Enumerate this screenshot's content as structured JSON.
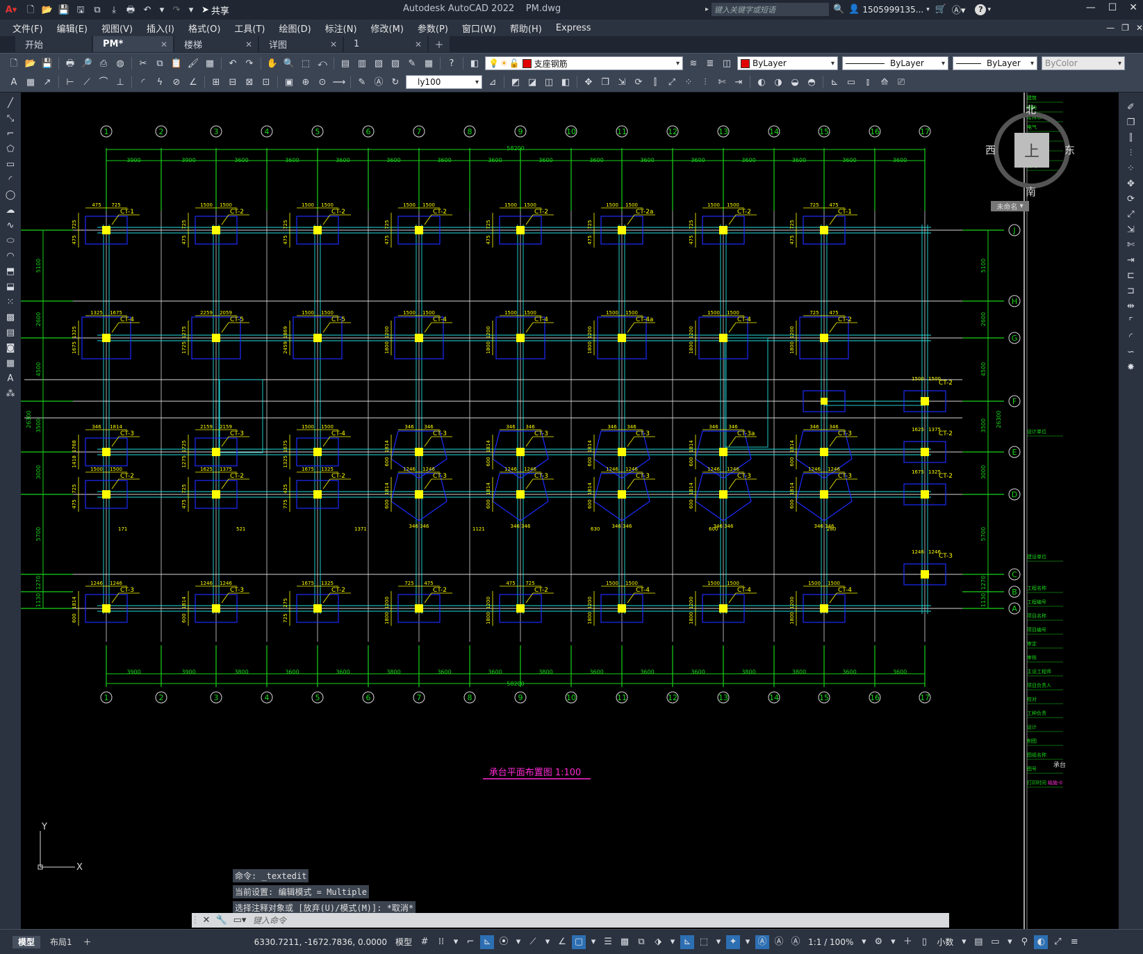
{
  "app": {
    "title": "Autodesk AutoCAD 2022",
    "file": "PM.dwg",
    "share_label": "共享",
    "search_placeholder": "键入关键字或短语",
    "user": "1505999135...",
    "window_controls": [
      "minimize-icon",
      "maximize-icon",
      "close-icon"
    ]
  },
  "menu": [
    "文件(F)",
    "编辑(E)",
    "视图(V)",
    "插入(I)",
    "格式(O)",
    "工具(T)",
    "绘图(D)",
    "标注(N)",
    "修改(M)",
    "参数(P)",
    "窗口(W)",
    "帮助(H)",
    "Express"
  ],
  "tabs": [
    {
      "label": "开始",
      "closable": false
    },
    {
      "label": "PM*",
      "closable": true,
      "active": true
    },
    {
      "label": "楼梯",
      "closable": true
    },
    {
      "label": "详图",
      "closable": true
    },
    {
      "label": "1",
      "closable": true
    }
  ],
  "properties": {
    "layer": "支座钢筋",
    "layer_color": "#e00000",
    "color": "ByLayer",
    "linetype": "ByLayer",
    "lineweight": "ByLayer",
    "plotstyle": "ByColor",
    "dimstyle": "ly100"
  },
  "viewcube": {
    "north": "北",
    "south": "南",
    "west": "西",
    "east": "东",
    "top": "上",
    "ucs": "未命名"
  },
  "drawing": {
    "top_axis_labels": [
      "1",
      "2",
      "3",
      "4",
      "5",
      "6",
      "7",
      "8",
      "9",
      "10",
      "11",
      "12",
      "13",
      "14",
      "15",
      "16",
      "17"
    ],
    "row_axis_labels": [
      "J",
      "H",
      "G",
      "F",
      "E",
      "D",
      "C",
      "B",
      "A"
    ],
    "bay_dims": [
      "3900",
      "3900",
      "3600",
      "3600",
      "3600",
      "3600",
      "3600",
      "3600",
      "3600",
      "3600",
      "3600",
      "3600",
      "3600",
      "3600",
      "3600",
      "3600"
    ],
    "bay_dims_bottom": [
      "3900",
      "3900",
      "3800",
      "3600",
      "3600",
      "3800",
      "3600",
      "3600",
      "3800",
      "3600",
      "3600",
      "3600",
      "3800",
      "3800",
      "3600",
      "3600"
    ],
    "overall_dim": "58200",
    "side_dims": [
      "5100",
      "2600",
      "4500",
      "3500",
      "3000",
      "5700",
      "1270",
      "1130"
    ],
    "side_total": "26300",
    "title": "承台平面布置图 1:100",
    "title_color": "#ff2bd6",
    "pile_caps": [
      {
        "label": "CT-1",
        "d1": "475",
        "d2": "725",
        "v1": "725",
        "v2": "475"
      },
      {
        "label": "CT-2",
        "d1": "1500",
        "d2": "1500",
        "v1": "725",
        "v2": "475"
      },
      {
        "label": "CT-2",
        "d1": "1500",
        "d2": "1500",
        "v1": "725",
        "v2": "475"
      },
      {
        "label": "CT-2",
        "d1": "1500",
        "d2": "1500",
        "v1": "725",
        "v2": "475"
      },
      {
        "label": "CT-2",
        "d1": "1500",
        "d2": "1500",
        "v1": "725",
        "v2": "475"
      },
      {
        "label": "CT-2a",
        "d1": "1500",
        "d2": "1500",
        "v1": "725",
        "v2": "475"
      },
      {
        "label": "CT-2",
        "d1": "1500",
        "d2": "1500",
        "v1": "725",
        "v2": "475"
      },
      {
        "label": "CT-1",
        "d1": "725",
        "d2": "475",
        "v1": "725",
        "v2": "475"
      },
      {
        "label": "CT-4",
        "d1": "1325",
        "d2": "1675",
        "v1": "1325",
        "v2": "1675"
      },
      {
        "label": "CT-5",
        "d1": "2259",
        "d2": "2059",
        "v1": "1275",
        "v2": "1725"
      },
      {
        "label": "CT-5",
        "d1": "1500",
        "d2": "1500",
        "v1": "1869",
        "v2": "2459"
      },
      {
        "label": "CT-4",
        "d1": "1500",
        "d2": "1500",
        "v1": "1200",
        "v2": "1800"
      },
      {
        "label": "CT-4",
        "d1": "1500",
        "d2": "1500",
        "v1": "1200",
        "v2": "1800"
      },
      {
        "label": "CT-4a",
        "d1": "1500",
        "d2": "1500",
        "v1": "1200",
        "v2": "1800"
      },
      {
        "label": "CT-4",
        "d1": "1500",
        "d2": "1500",
        "v1": "1200",
        "v2": "1800"
      },
      {
        "label": "CT-2",
        "d1": "725",
        "d2": "475",
        "v1": "1200",
        "v2": "1800"
      },
      {
        "label": "CT-3",
        "d1": "346",
        "d2": "1814",
        "v1": "1768",
        "v2": "1418"
      },
      {
        "label": "CT-3",
        "d1": "2159",
        "d2": "2159",
        "v1": "1725",
        "v2": "1275"
      },
      {
        "label": "CT-4",
        "d1": "1500",
        "d2": "1500",
        "v1": "1675",
        "v2": "1325"
      },
      {
        "label": "CT-3",
        "d1": "346",
        "d2": "346",
        "v1": "1814",
        "v2": "600"
      },
      {
        "label": "CT-3",
        "d1": "346",
        "d2": "346",
        "v1": "1814",
        "v2": "600"
      },
      {
        "label": "CT-3",
        "d1": "346",
        "d2": "346",
        "v1": "1814",
        "v2": "600"
      },
      {
        "label": "CT-3a",
        "d1": "346",
        "d2": "346",
        "v1": "1814",
        "v2": "600"
      },
      {
        "label": "CT-3",
        "d1": "346",
        "d2": "346",
        "v1": "1814",
        "v2": "600"
      },
      {
        "label": "CT-2",
        "d1": "1500",
        "d2": "1500",
        "v1": "725",
        "v2": "475"
      },
      {
        "label": "CT-2",
        "d1": "1625",
        "d2": "1375",
        "v1": "725",
        "v2": "475"
      },
      {
        "label": "CT-2",
        "d1": "1675",
        "d2": "1325",
        "v1": "425",
        "v2": "775"
      },
      {
        "label": "CT-3",
        "d1": "1246",
        "d2": "1246",
        "v1": "1814",
        "v2": "600"
      },
      {
        "label": "CT-3",
        "d1": "1246",
        "d2": "1246",
        "v1": "1814",
        "v2": "600"
      },
      {
        "label": "CT-3",
        "d1": "1246",
        "d2": "1246",
        "v1": "1814",
        "v2": "600"
      },
      {
        "label": "CT-3",
        "d1": "1246",
        "d2": "1246",
        "v1": "1814",
        "v2": "600"
      },
      {
        "label": "CT-3",
        "d1": "1246",
        "d2": "1246",
        "v1": "1814",
        "v2": "600"
      },
      {
        "label": "CT-3",
        "d1": "1246",
        "d2": "1246",
        "v1": "1814",
        "v2": "600"
      },
      {
        "label": "CT-3",
        "d1": "1246",
        "d2": "1246",
        "v1": "1814",
        "v2": "600"
      },
      {
        "label": "CT-2",
        "d1": "1675",
        "d2": "1325",
        "v1": "275",
        "v2": "725"
      },
      {
        "label": "CT-2",
        "d1": "725",
        "d2": "475",
        "v1": "1200",
        "v2": "1800"
      },
      {
        "label": "CT-2",
        "d1": "475",
        "d2": "725",
        "v1": "1200",
        "v2": "1800"
      },
      {
        "label": "CT-4",
        "d1": "1500",
        "d2": "1500",
        "v1": "1200",
        "v2": "1800"
      },
      {
        "label": "CT-4",
        "d1": "1500",
        "d2": "1500",
        "v1": "1200",
        "v2": "1800"
      },
      {
        "label": "CT-4",
        "d1": "1500",
        "d2": "1500",
        "v1": "1200",
        "v2": "1800"
      },
      {
        "label": "CT-4",
        "d1": "1500",
        "d2": "1500",
        "v1": "1200",
        "v2": "1800"
      },
      {
        "label": "CT-4",
        "d1": "1500",
        "d2": "1500",
        "v1": "1200",
        "v2": "1800"
      },
      {
        "label": "CT-4",
        "d1": "1500",
        "d2": "1500",
        "v1": "1200",
        "v2": "1800"
      },
      {
        "label": "CT-3",
        "d1": "471",
        "d2": "121",
        "v1": "1339",
        "v2": "600"
      }
    ],
    "bottom_dims_d3": [
      "346",
      "346",
      "346",
      "346",
      "346",
      "346",
      "346"
    ],
    "misc_dims": [
      "171",
      "521",
      "1371",
      "1121",
      "630",
      "600",
      "280"
    ],
    "ucs_y": "Y",
    "ucs_x": "X"
  },
  "titleblock": {
    "rows": [
      "建筑",
      "结构",
      "给排水",
      "电气",
      "暖通",
      "智能",
      "消防",
      "燃气",
      "设计单位",
      "建设单位",
      "工程名称",
      "工程编号",
      "项目名称",
      "项目编号",
      "审定",
      "审核",
      "主设工程师",
      "项目负责人",
      "校对",
      "工种负责",
      "设计",
      "制图",
      "图纸名称",
      "图号",
      "打印时间"
    ],
    "drawing_name": "承台",
    "drawing_no": "结施-0"
  },
  "command": {
    "history": [
      "命令:  _textedit",
      "当前设置: 编辑模式 = Multiple",
      "选择注释对象或 [放弃(U)/模式(M)]: *取消*"
    ],
    "placeholder": "键入命令"
  },
  "status": {
    "layout_tabs": [
      "模型",
      "布局1"
    ],
    "coords": "6330.7211, -1672.7836, 0.0000",
    "space": "模型",
    "scale": "1:1 / 100%",
    "units": "小数"
  }
}
